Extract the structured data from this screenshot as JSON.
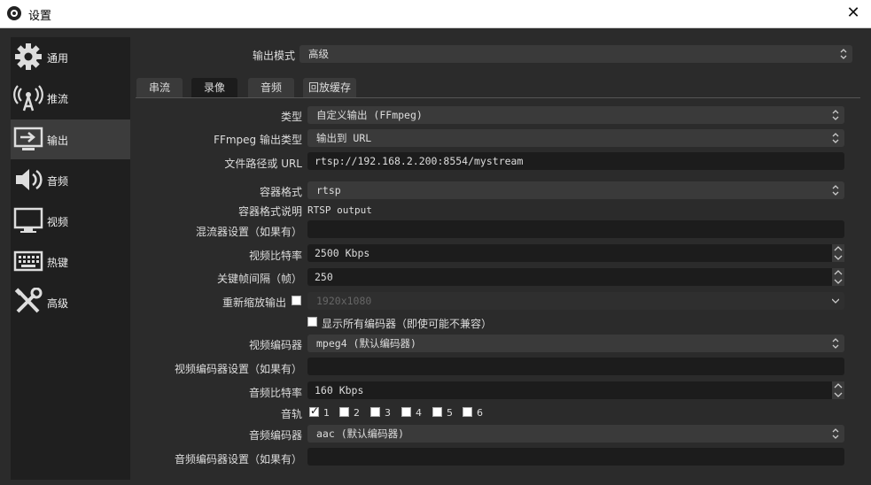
{
  "window": {
    "title": "设置",
    "close_label": "✕"
  },
  "sidebar": {
    "items": [
      {
        "label": "通用",
        "icon": "gear-icon"
      },
      {
        "label": "推流",
        "icon": "broadcast-antenna-icon"
      },
      {
        "label": "输出",
        "icon": "monitor-output-icon",
        "active": true
      },
      {
        "label": "音频",
        "icon": "speaker-icon"
      },
      {
        "label": "视频",
        "icon": "monitor-icon"
      },
      {
        "label": "热键",
        "icon": "keyboard-icon"
      },
      {
        "label": "高级",
        "icon": "tools-icon"
      }
    ]
  },
  "output_mode": {
    "label": "输出模式",
    "value": "高级"
  },
  "tabs": [
    {
      "label": "串流"
    },
    {
      "label": "录像",
      "active": true
    },
    {
      "label": "音频"
    },
    {
      "label": "回放缓存"
    }
  ],
  "form": {
    "type": {
      "label": "类型",
      "value": "自定义输出 (FFmpeg)"
    },
    "ffmpeg_output_type": {
      "label": "FFmpeg 输出类型",
      "value": "输出到 URL"
    },
    "file_path_url": {
      "label": "文件路径或 URL",
      "value": "rtsp://192.168.2.200:8554/mystream"
    },
    "container_format": {
      "label": "容器格式",
      "value": "rtsp"
    },
    "container_desc": {
      "label": "容器格式说明",
      "value": "RTSP output"
    },
    "muxer_settings": {
      "label": "混流器设置（如果有）",
      "value": ""
    },
    "video_bitrate": {
      "label": "视频比特率",
      "value": "2500 Kbps"
    },
    "keyframe_interval": {
      "label": "关键帧间隔（帧）",
      "value": "250"
    },
    "rescale_output": {
      "label": "重新缩放输出",
      "checked": false,
      "value": "1920x1080"
    },
    "show_all_encoders": {
      "label": "显示所有编码器（即使可能不兼容）",
      "checked": false
    },
    "video_encoder": {
      "label": "视频编码器",
      "value": "mpeg4 (默认编码器)"
    },
    "video_encoder_settings": {
      "label": "视频编码器设置（如果有）",
      "value": ""
    },
    "audio_bitrate": {
      "label": "音频比特率",
      "value": "160 Kbps"
    },
    "audio_track": {
      "label": "音轨",
      "tracks": [
        {
          "num": "1",
          "checked": true
        },
        {
          "num": "2",
          "checked": false
        },
        {
          "num": "3",
          "checked": false
        },
        {
          "num": "4",
          "checked": false
        },
        {
          "num": "5",
          "checked": false
        },
        {
          "num": "6",
          "checked": false
        }
      ]
    },
    "audio_encoder": {
      "label": "音频编码器",
      "value": "aac (默认编码器)"
    },
    "audio_encoder_settings": {
      "label": "音频编码器设置（如果有）",
      "value": ""
    }
  }
}
